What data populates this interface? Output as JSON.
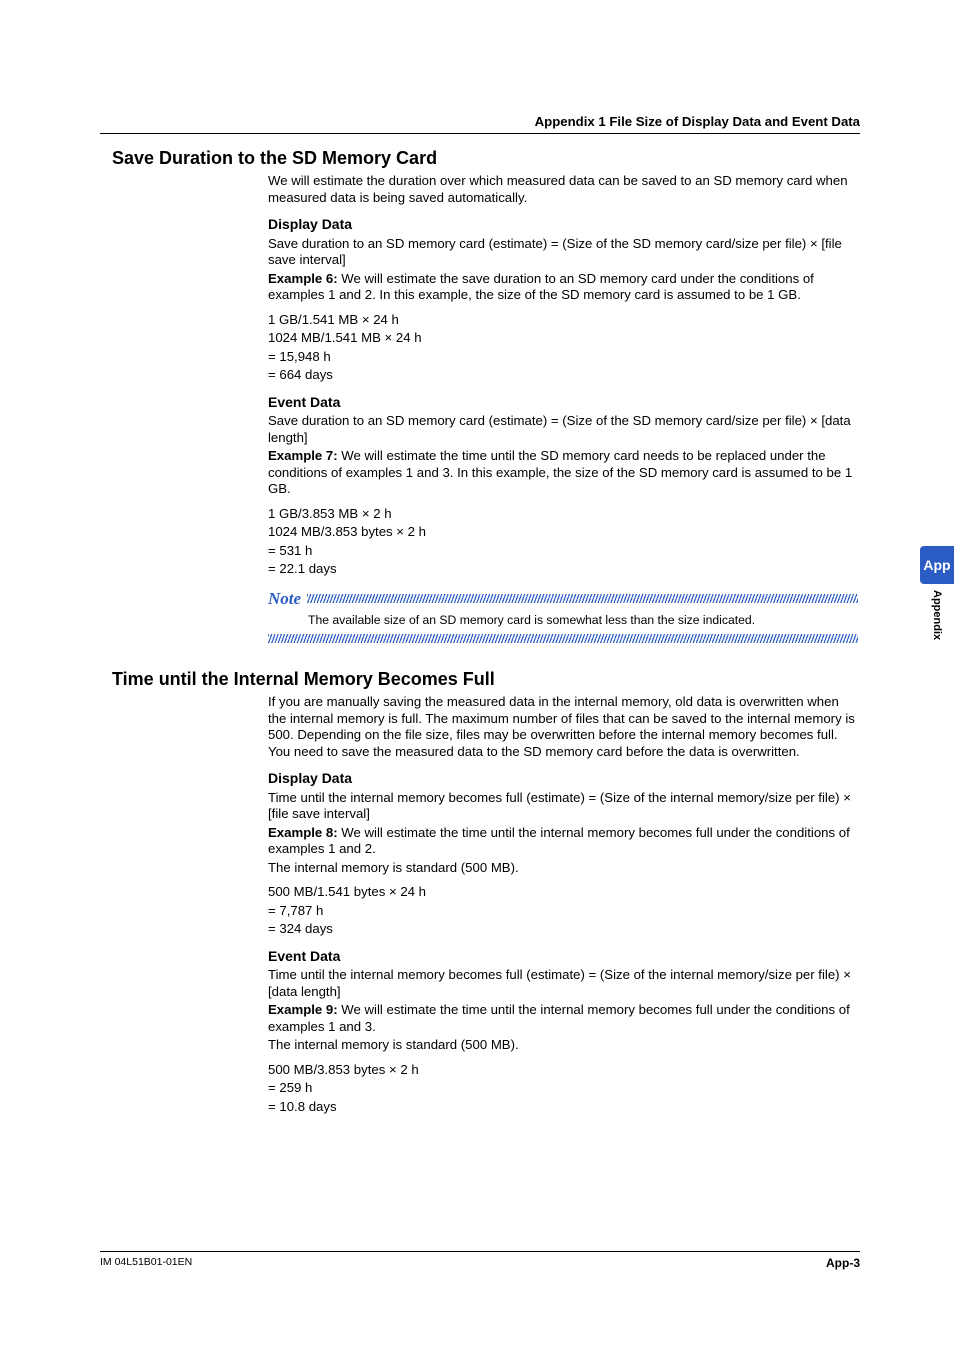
{
  "header": {
    "running": "Appendix 1 File Size of Display Data and Event Data"
  },
  "side": {
    "tab": "App",
    "label": "Appendix"
  },
  "footer": {
    "left": "IM 04L51B01-01EN",
    "right": "App-3"
  },
  "s1": {
    "title": "Save Duration to the SD Memory Card",
    "intro": "We will estimate the duration over which measured data can be saved to an SD memory card when measured data is being saved automatically.",
    "dd": {
      "head": "Display Data",
      "formula": "Save duration to an SD memory card (estimate) = (Size of the SD memory card/size per file) × [file save interval]",
      "ex_label": "Example 6:",
      "ex_text": " We will estimate the save duration to an SD memory card under the conditions of examples 1 and 2. In this example, the size of the SD memory card is assumed to be 1 GB.",
      "c1": "1 GB/1.541 MB × 24 h",
      "c2": "1024 MB/1.541 MB × 24 h",
      "c3": "= 15,948 h",
      "c4": "= 664 days"
    },
    "ed": {
      "head": "Event Data",
      "formula": "Save duration to an SD memory card (estimate) = (Size of the SD memory card/size per file) × [data length]",
      "ex_label": "Example 7:",
      "ex_text": " We will estimate the time until the SD memory card needs to be replaced under the conditions of examples 1 and 3. In this example, the size of the SD memory card is assumed to be 1 GB.",
      "c1": "1 GB/3.853 MB × 2 h",
      "c2": "1024 MB/3.853 bytes × 2 h",
      "c3": "= 531 h",
      "c4": "= 22.1 days"
    },
    "note": {
      "label": "Note",
      "text": "The available size of an SD memory card is somewhat less than the size indicated."
    }
  },
  "s2": {
    "title": "Time until the Internal Memory Becomes Full",
    "intro": "If you are manually saving the measured data in the internal memory, old data is overwritten when the internal memory is full. The maximum number of files that can be saved to the internal memory is 500. Depending on the file size, files may be overwritten before the internal memory becomes full. You need to save the measured data to the SD memory card before the data is overwritten.",
    "dd": {
      "head": "Display Data",
      "formula": "Time until the internal memory becomes full (estimate) = (Size of the internal memory/size per file) × [file save interval]",
      "ex_label": "Example 8:",
      "ex_text": " We will estimate the time until the internal memory becomes full under the conditions of examples 1 and 2.",
      "mem": "The internal memory is standard (500 MB).",
      "c1": "500 MB/1.541 bytes × 24 h",
      "c2": "= 7,787 h",
      "c3": "= 324 days"
    },
    "ed": {
      "head": "Event Data",
      "formula": "Time until the internal memory becomes full (estimate) = (Size of the internal memory/size per file) × [data length]",
      "ex_label": "Example 9:",
      "ex_text": " We will estimate the time until the internal memory becomes full under the conditions of examples 1 and 3.",
      "mem": "The internal memory is standard (500 MB).",
      "c1": "500 MB/3.853 bytes × 2 h",
      "c2": "= 259 h",
      "c3": "= 10.8 days"
    }
  }
}
